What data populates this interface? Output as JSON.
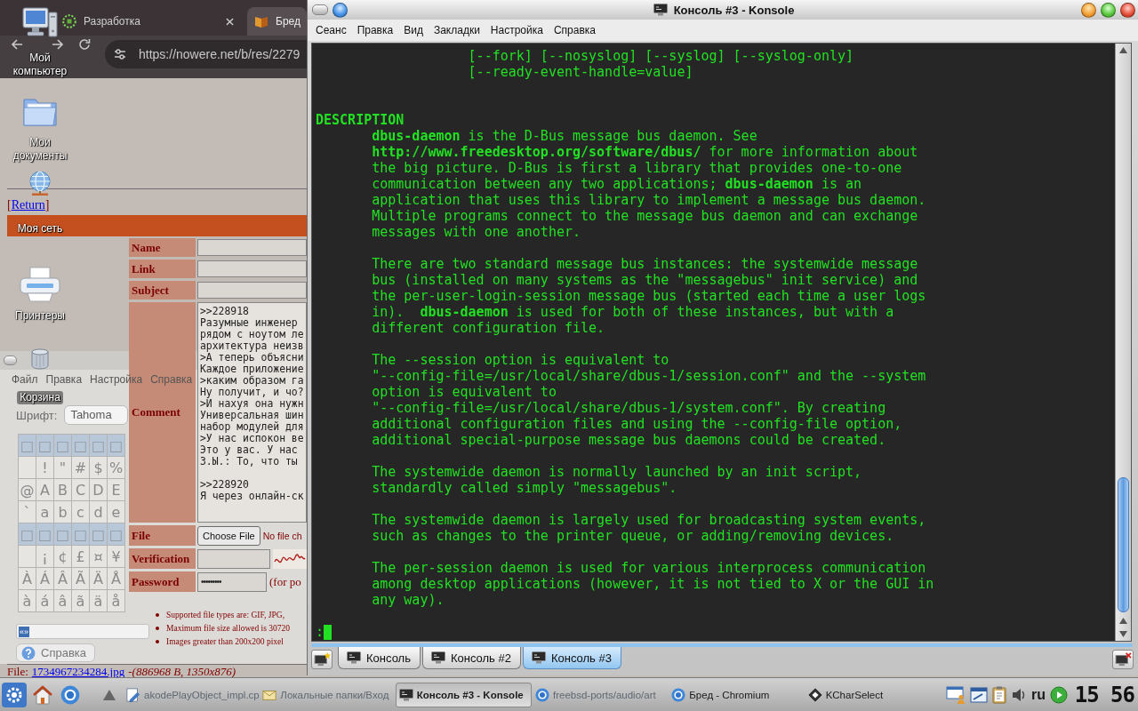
{
  "desktop": {
    "icons": [
      {
        "kind": "computer",
        "label": "Мой компьютер"
      },
      {
        "kind": "folder",
        "label": "Мои документы"
      },
      {
        "kind": "network",
        "label": "Моя сеть"
      },
      {
        "kind": "printer",
        "label": "Принтеры"
      },
      {
        "kind": "trash",
        "label": "Корзина"
      }
    ]
  },
  "browser": {
    "tabs": [
      {
        "kind": "dev",
        "title": "Разработка",
        "selected": false,
        "closable": true
      },
      {
        "kind": "board",
        "title": "Бред",
        "selected": true,
        "closable": false
      }
    ],
    "url": "https://nowere.net/b/res/2279",
    "return_nav": {
      "before": "[",
      "link": "Return",
      "after": "]"
    },
    "form": {
      "rows": [
        {
          "kind": "text",
          "label": "Name"
        },
        {
          "kind": "text",
          "label": "Link"
        },
        {
          "kind": "text",
          "label": "Subject"
        },
        {
          "kind": "textarea",
          "label": "Comment",
          "value": ">>228918\nРазумные инженер\nрядом с ноутом ле\nархитектура неизв\n>А теперь объясни\nКаждое приложение\n>каким образом га\nНу получит, и чо?\n>И нахуя она нужн\nУниверсальная шин\nнабор модулей для\n>У нас испокон ве\nЭто у вас. У нас\nЗ.Ы.: То, что ты\n\n>>228920\nЯ через онлайн-ск"
        },
        {
          "kind": "file",
          "label": "File",
          "button": "Choose File",
          "note": "No file ch"
        },
        {
          "kind": "captcha",
          "label": "Verification"
        },
        {
          "kind": "password",
          "label": "Password",
          "value": "•••••••••",
          "note": "(for po"
        }
      ]
    },
    "rules": [
      "Supported file types are: GIF, JPG,",
      "Maximum file size allowed is 30720",
      "Images greater than 200x200 pixel"
    ],
    "file_info": {
      "label": "File:",
      "link": "1734967234284.jpg",
      "details": "-(886968 B, 1350x876)"
    }
  },
  "charselect": {
    "menu": [
      "Файл",
      "Правка",
      "Настройка",
      "Справка"
    ],
    "font_label": "Шрифт:",
    "font": "Tahoma",
    "grid_rows": [
      {
        "kind": "control",
        "cells": [
          "□",
          "□",
          "□",
          "□",
          "□",
          "□"
        ]
      },
      {
        "kind": "printable",
        "cells": [
          null,
          "!",
          "\"",
          "#",
          "$",
          "%"
        ]
      },
      {
        "kind": "printable",
        "cells": [
          "@",
          "A",
          "B",
          "C",
          "D",
          "E"
        ]
      },
      {
        "kind": "printable",
        "cells": [
          "`",
          "a",
          "b",
          "c",
          "d",
          "e"
        ]
      },
      {
        "kind": "control",
        "cells": [
          "□",
          "□",
          "□",
          "□",
          "□",
          "□"
        ]
      },
      {
        "kind": "printable",
        "cells": [
          null,
          "¡",
          "¢",
          "£",
          "¤",
          "¥"
        ]
      },
      {
        "kind": "printable",
        "cells": [
          "À",
          "Á",
          "Â",
          "Ã",
          "Ä",
          "Å"
        ]
      },
      {
        "kind": "printable",
        "cells": [
          "à",
          "á",
          "â",
          "ã",
          "ä",
          "å"
        ]
      }
    ],
    "text_field": {
      "value": "«»"
    },
    "help_button": "Справка"
  },
  "konsole": {
    "title": "Консоль #3 - Konsole",
    "menu": [
      "Сеанс",
      "Правка",
      "Вид",
      "Закладки",
      "Настройка",
      "Справка"
    ],
    "screen": {
      "blocks": [
        {
          "kind": "synopsis",
          "lines": [
            "[--fork] [--nosyslog] [--syslog] [--syslog-only]",
            "[--ready-event-handle=value]"
          ]
        },
        {
          "kind": "heading",
          "lines": [
            "DESCRIPTION"
          ]
        },
        {
          "kind": "body",
          "lines": [
            "**dbus-daemon** is the D-Bus message bus daemon. See",
            "**http://www.freedesktop.org/software/dbus/** for more information about",
            "the big picture. D-Bus is first a library that provides one-to-one",
            "communication between any two applications; **dbus-daemon** is an",
            "application that uses this library to implement a message bus daemon.",
            "Multiple programs connect to the message bus daemon and can exchange",
            "messages with one another."
          ]
        },
        {
          "kind": "body",
          "lines": [
            "There are two standard message bus instances: the systemwide message",
            "bus (installed on many systems as the \"messagebus\" init service) and",
            "the per-user-login-session message bus (started each time a user logs",
            "in).  **dbus-daemon** is used for both of these instances, but with a",
            "different configuration file."
          ]
        },
        {
          "kind": "body",
          "lines": [
            "The --session option is equivalent to",
            "\"--config-file=/usr/local/share/dbus-1/session.conf\" and the --system",
            "option is equivalent to",
            "\"--config-file=/usr/local/share/dbus-1/system.conf\". By creating",
            "additional configuration files and using the --config-file option,",
            "additional special-purpose message bus daemons could be created."
          ]
        },
        {
          "kind": "body",
          "lines": [
            "The systemwide daemon is normally launched by an init script,",
            "standardly called simply \"messagebus\"."
          ]
        },
        {
          "kind": "body",
          "lines": [
            "The systemwide daemon is largely used for broadcasting system events,",
            "such as changes to the printer queue, or adding/removing devices."
          ]
        },
        {
          "kind": "body",
          "lines": [
            "The per-session daemon is used for various interprocess communication",
            "among desktop applications (however, it is not tied to X or the GUI in",
            "any way)."
          ]
        }
      ],
      "prompt": ":"
    },
    "tabs": [
      {
        "label": "Консоль",
        "selected": false
      },
      {
        "label": "Консоль #2",
        "selected": false
      },
      {
        "label": "Консоль #3",
        "selected": true
      }
    ]
  },
  "taskbar": {
    "tasks": [
      {
        "kind": "editor",
        "title": "akodePlayObject_impl.cp",
        "selected": false,
        "minimized": true
      },
      {
        "kind": "mail",
        "title": "Локальные папки/Вход",
        "selected": false,
        "minimized": true
      },
      {
        "kind": "terminal",
        "title": "Консоль #3 - Konsole",
        "selected": true,
        "minimized": false
      },
      {
        "kind": "browser",
        "title": "freebsd-ports/audio/art",
        "selected": false,
        "minimized": true
      },
      {
        "kind": "browser",
        "title": "Бред - Chromium",
        "selected": false,
        "minimized": false
      },
      {
        "kind": "charselect",
        "title": "KCharSelect",
        "selected": false,
        "minimized": false
      }
    ],
    "keyboard_layout": "ru",
    "clock": "15 56"
  }
}
